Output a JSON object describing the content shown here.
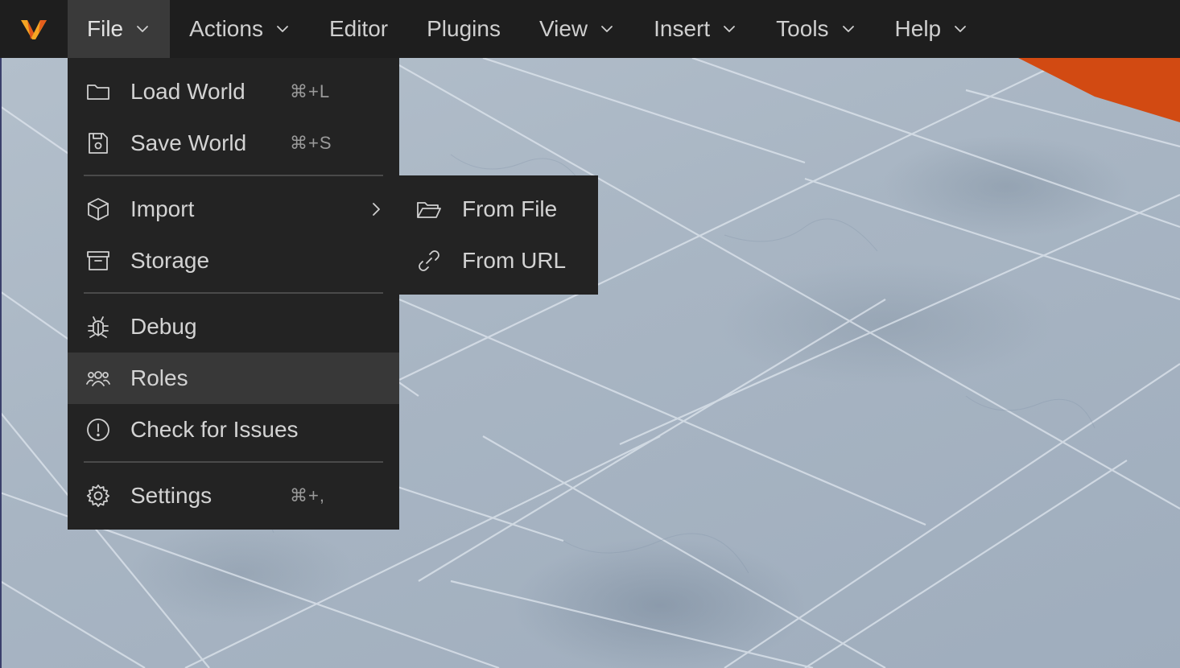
{
  "menubar": {
    "items": [
      {
        "label": "File",
        "has_chevron": true,
        "active": true
      },
      {
        "label": "Actions",
        "has_chevron": true
      },
      {
        "label": "Editor",
        "has_chevron": false
      },
      {
        "label": "Plugins",
        "has_chevron": false
      },
      {
        "label": "View",
        "has_chevron": true
      },
      {
        "label": "Insert",
        "has_chevron": true
      },
      {
        "label": "Tools",
        "has_chevron": true
      },
      {
        "label": "Help",
        "has_chevron": true
      }
    ],
    "logo_icon": "v-logo-icon",
    "logo_colors": [
      "#f5a623",
      "#e0501b"
    ]
  },
  "file_menu": {
    "items": [
      {
        "label": "Load World",
        "shortcut": "⌘+L",
        "icon": "folder-icon"
      },
      {
        "label": "Save World",
        "shortcut": "⌘+S",
        "icon": "save-icon"
      },
      {
        "label": "Import",
        "icon": "cube-icon",
        "has_submenu": true
      },
      {
        "label": "Storage",
        "icon": "archive-icon"
      },
      {
        "label": "Debug",
        "icon": "bug-icon"
      },
      {
        "label": "Roles",
        "icon": "users-icon",
        "hovered": true
      },
      {
        "label": "Check for Issues",
        "icon": "alert-circle-icon"
      },
      {
        "label": "Settings",
        "shortcut": "⌘+,",
        "icon": "gear-icon"
      }
    ]
  },
  "import_submenu": {
    "items": [
      {
        "label": "From File",
        "icon": "folder-open-icon"
      },
      {
        "label": "From URL",
        "icon": "link-icon"
      }
    ]
  },
  "colors": {
    "menubar_bg": "#1e1e1e",
    "menu_bg": "#232323",
    "hover_bg": "#383838",
    "accent_orange": "#d24a12"
  }
}
